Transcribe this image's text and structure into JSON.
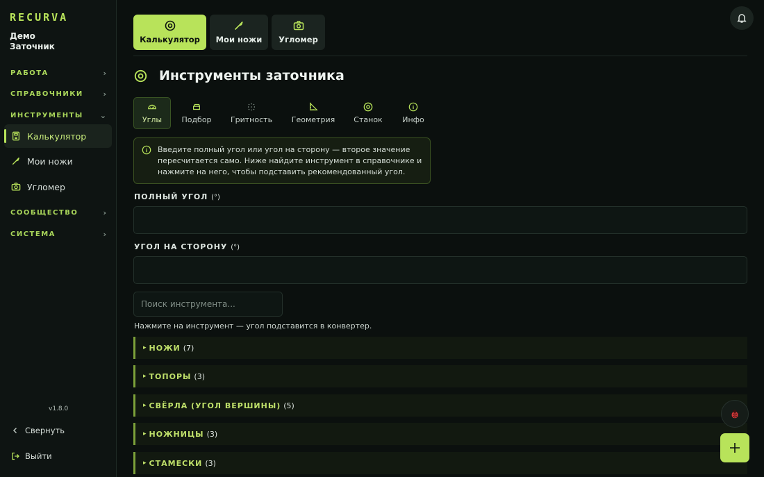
{
  "sidebar": {
    "logo": "RECURVA",
    "user_line1": "Демо",
    "user_line2": "Заточник",
    "sections": {
      "work": "РАБОТА",
      "references": "СПРАВОЧНИКИ",
      "tools": "ИНСТРУМЕНТЫ",
      "community": "СООБЩЕСТВО",
      "system": "СИСТЕМА"
    },
    "items": [
      {
        "label": "Калькулятор",
        "icon": "calculator-icon"
      },
      {
        "label": "Мои ножи",
        "icon": "knife-icon"
      },
      {
        "label": "Угломер",
        "icon": "camera-icon"
      }
    ],
    "version": "v1.8.0",
    "collapse_label": "Свернуть",
    "logout_label": "Выйти"
  },
  "top_tabs": [
    {
      "label": "Калькулятор",
      "icon": "target-icon"
    },
    {
      "label": "Мои ножи",
      "icon": "knife-icon"
    },
    {
      "label": "Угломер",
      "icon": "camera-icon"
    }
  ],
  "page": {
    "title": "Инструменты заточника"
  },
  "sub_tabs": [
    {
      "label": "Углы",
      "icon": "gauge-icon"
    },
    {
      "label": "Подбор",
      "icon": "stone-icon"
    },
    {
      "label": "Гритность",
      "icon": "grit-icon"
    },
    {
      "label": "Геометрия",
      "icon": "triangle-ruler-icon"
    },
    {
      "label": "Станок",
      "icon": "target-icon"
    },
    {
      "label": "Инфо",
      "icon": "info-icon"
    }
  ],
  "info": {
    "text_line1": "Введите полный угол или угол на сторону — второе значение",
    "text_line2": "пересчитается само. Ниже найдите инструмент в справочнике и",
    "text_line3": "нажмите на него, чтобы подставить рекомендованный угол."
  },
  "form": {
    "full_angle_label": "ПОЛНЫЙ УГОЛ",
    "side_angle_label": "УГОЛ НА СТОРОНУ",
    "unit": "(°)",
    "full_angle_value": "",
    "side_angle_value": "",
    "search_placeholder": "Поиск инструмента...",
    "hint": "Нажмите на инструмент — угол подставится в конвертер."
  },
  "groups": [
    {
      "name": "НОЖИ",
      "count": "(7)"
    },
    {
      "name": "ТОПОРЫ",
      "count": "(3)"
    },
    {
      "name": "СВЁРЛА (УГОЛ ВЕРШИНЫ)",
      "count": "(5)"
    },
    {
      "name": "НОЖНИЦЫ",
      "count": "(3)"
    },
    {
      "name": "СТАМЕСКИ",
      "count": "(3)"
    }
  ],
  "colors": {
    "accent": "#b8e35a",
    "background": "#0b100e",
    "sidebar": "#0e1412"
  }
}
